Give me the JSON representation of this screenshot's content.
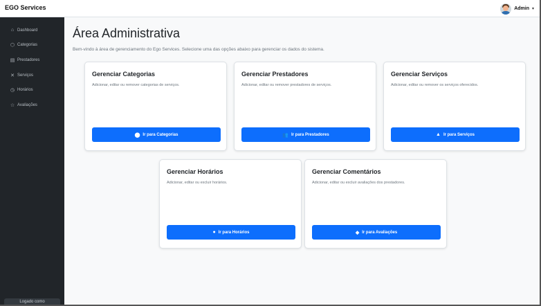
{
  "app": {
    "brand": "EGO Services"
  },
  "user": {
    "name": "Admin",
    "caret": "▾"
  },
  "sidebar": {
    "items": [
      {
        "icon": "⌂",
        "label": "Dashboard",
        "icon_name": "dashboard-icon"
      },
      {
        "icon": "⬡",
        "label": "Categorias",
        "icon_name": "tag-icon"
      },
      {
        "icon": "▤",
        "label": "Prestadores",
        "icon_name": "id-card-icon"
      },
      {
        "icon": "✕",
        "label": "Serviços",
        "icon_name": "tools-icon"
      },
      {
        "icon": "◷",
        "label": "Horários",
        "icon_name": "clock-icon"
      },
      {
        "icon": "☆",
        "label": "Avaliações",
        "icon_name": "star-icon"
      }
    ],
    "footer": "Logado como"
  },
  "main": {
    "title": "Área Administrativa",
    "subtitle": "Bem-vindo à área de gerenciamento do Ego Services. Selecione uma das opções abaixo para gerenciar os dados do sistema.",
    "cards": [
      {
        "title": "Gerenciar Categorias",
        "desc": "Adicionar, editar ou remover categorias de serviços.",
        "button": "Ir para Categorias",
        "icon": "⬤",
        "icon_name": "tag-icon"
      },
      {
        "title": "Gerenciar Prestadores",
        "desc": "Adicionar, editar ou remover prestadores de serviços.",
        "button": "Ir para Prestadores",
        "icon": "👥",
        "icon_name": "users-icon"
      },
      {
        "title": "Gerenciar Serviços",
        "desc": "Adicionar, editar ou remover os serviços oferecidos.",
        "button": "Ir para Serviços",
        "icon": "▲",
        "icon_name": "tools-icon"
      },
      {
        "title": "Gerenciar Horários",
        "desc": "Adicionar, editar ou excluir horários.",
        "button": "Ir para Horários",
        "icon": "●",
        "icon_name": "clock-icon"
      },
      {
        "title": "Gerenciar Comentários",
        "desc": "Adicionar, editar ou excluir avaliações dos prestadores.",
        "button": "Ir para Avaliações",
        "icon": "◆",
        "icon_name": "comments-icon"
      }
    ]
  },
  "colors": {
    "primary": "#0d6efd",
    "sidebar": "#212529",
    "background": "#f8f9fa"
  }
}
